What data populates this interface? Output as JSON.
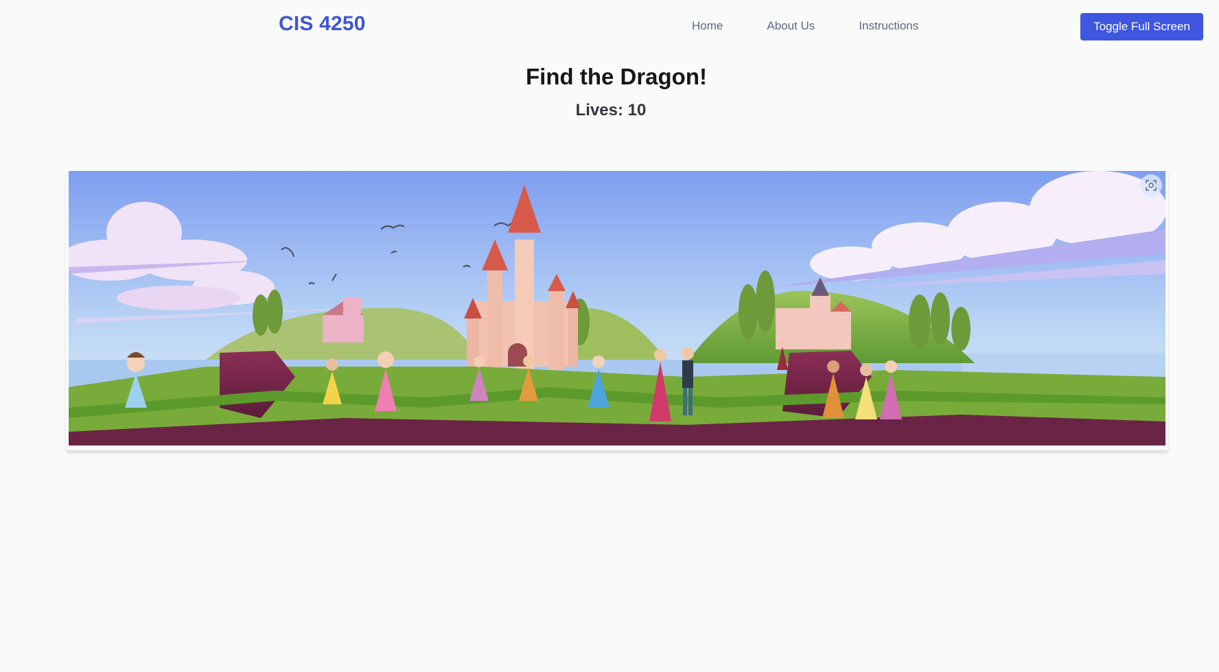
{
  "header": {
    "brand": "CIS 4250",
    "nav": [
      {
        "label": "Home"
      },
      {
        "label": "About Us"
      },
      {
        "label": "Instructions"
      }
    ],
    "fullscreen_label": "Toggle Full Screen"
  },
  "game": {
    "title": "Find the Dragon!",
    "lives_text": "Lives: 10"
  },
  "scene": {
    "icon": "screenshot-focus-icon",
    "colors": {
      "sky_top": "#7f9ff0",
      "sky_bottom": "#e2f4f6",
      "water": "#a9c8f0",
      "grass": "#7fae3a",
      "cliff": "#7a2a4a",
      "castle": "#f0b8a6",
      "roof": "#d85a4a",
      "primary": "#3e56e0"
    }
  }
}
